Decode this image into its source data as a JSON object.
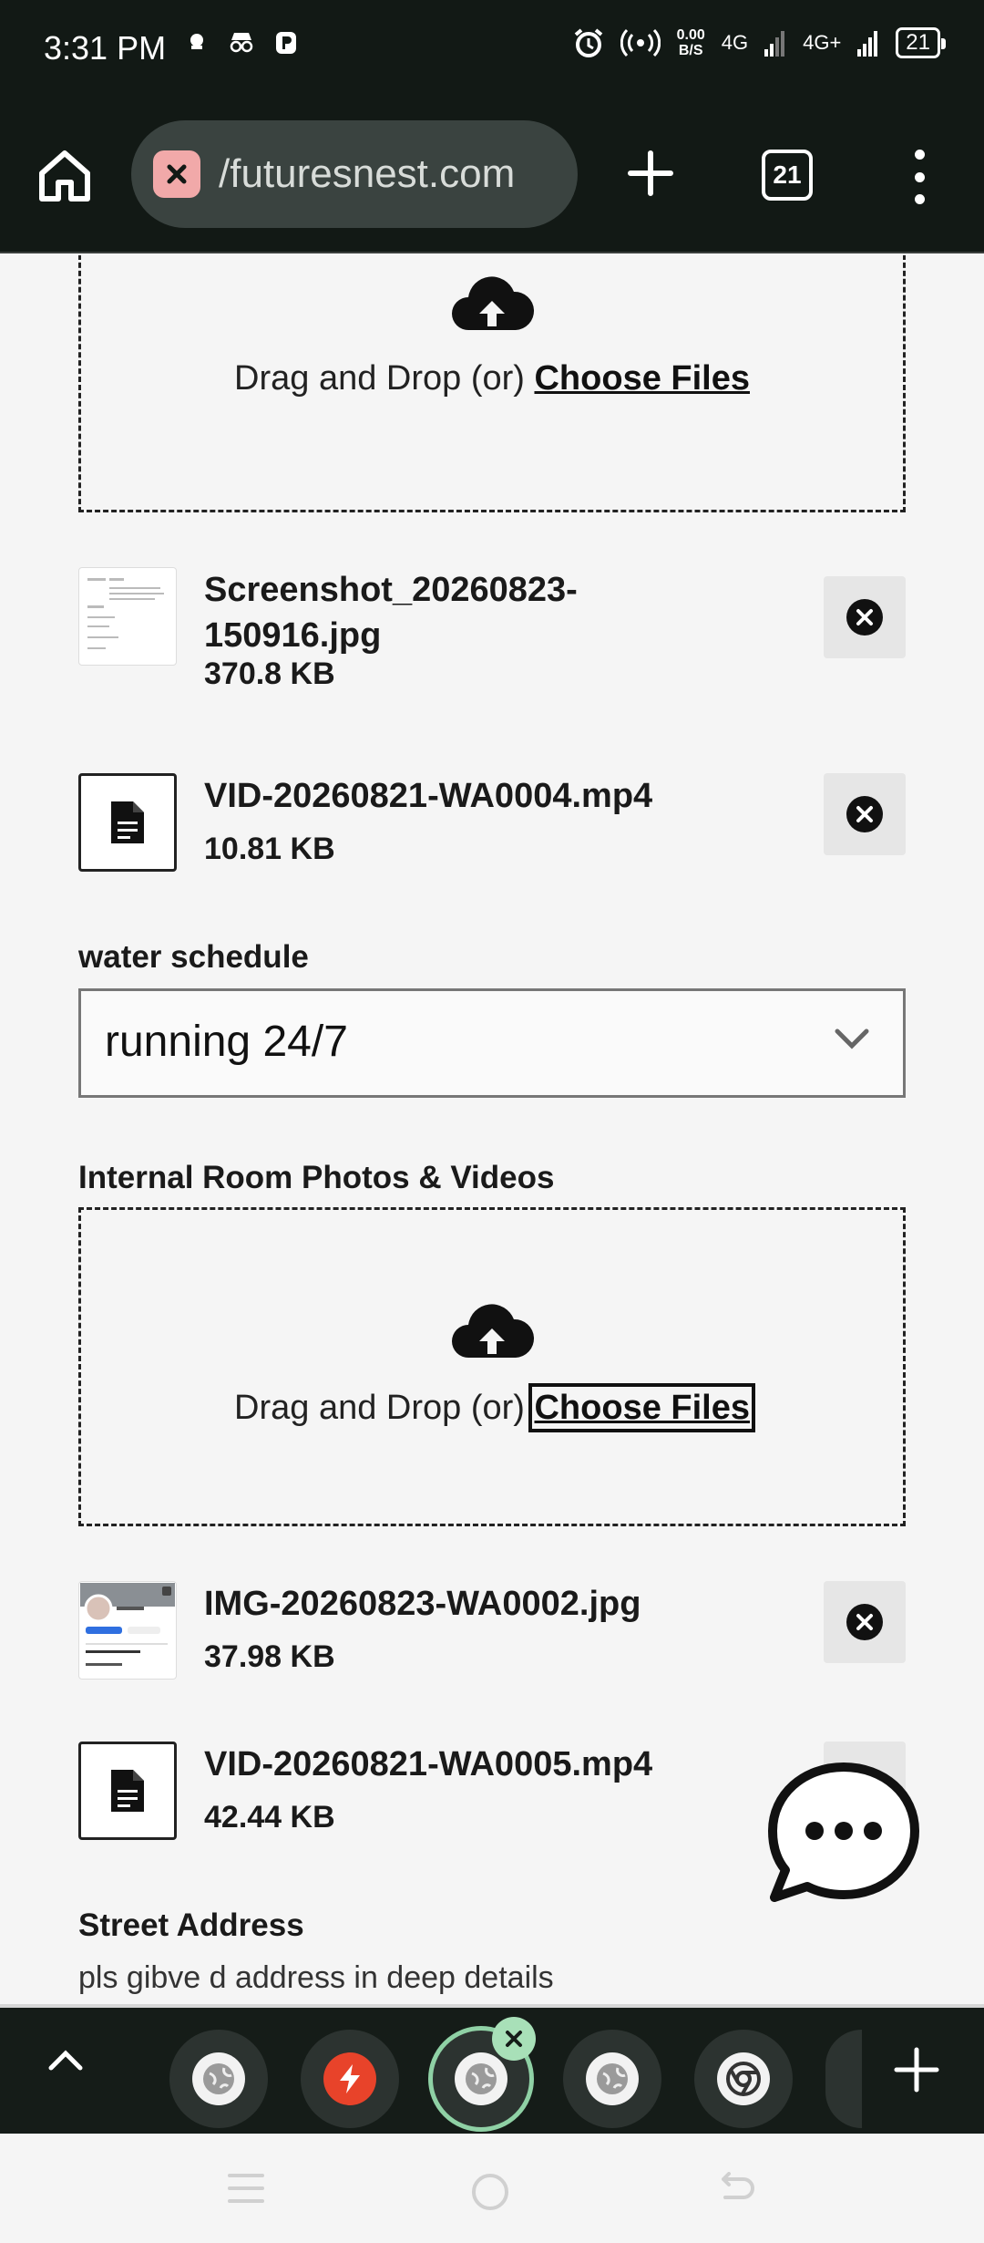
{
  "status_bar": {
    "time": "3:31 PM",
    "net_speed_value": "0.00",
    "net_speed_unit": "B/S",
    "network_1": "4G",
    "network_2": "4G+",
    "battery": "21"
  },
  "toolbar": {
    "url": "/futuresnest.com",
    "tab_count": "21"
  },
  "upload_1": {
    "drag_text": "Drag and Drop (or) ",
    "choose_label": "Choose Files",
    "files": [
      {
        "name": "Screenshot_20260823-150916.jpg",
        "size": "370.8 KB",
        "kind": "image"
      },
      {
        "name": "VID-20260821-WA0004.mp4",
        "size": "10.81 KB",
        "kind": "document"
      }
    ]
  },
  "water_schedule": {
    "label": "water schedule",
    "value": "running 24/7"
  },
  "upload_2": {
    "label": "Internal Room Photos & Videos",
    "drag_text": "Drag and Drop (or) ",
    "choose_label": "Choose Files",
    "files": [
      {
        "name": "IMG-20260823-WA0002.jpg",
        "size": "37.98 KB",
        "kind": "image"
      },
      {
        "name": "VID-20260821-WA0005.mp4",
        "size": "42.44 KB",
        "kind": "document"
      }
    ]
  },
  "street_address": {
    "label": "Street Address",
    "hint": "pls gibve d address in deep details"
  },
  "icons": {
    "home": "home-icon",
    "insecure": "insecure-site-icon",
    "new_tab": "plus-icon",
    "menu": "more-vert-icon",
    "upload": "cloud-upload-icon",
    "document": "document-icon",
    "remove": "close-circle-icon",
    "chevron": "chevron-down-icon",
    "chat": "chat-bubble-icon"
  }
}
